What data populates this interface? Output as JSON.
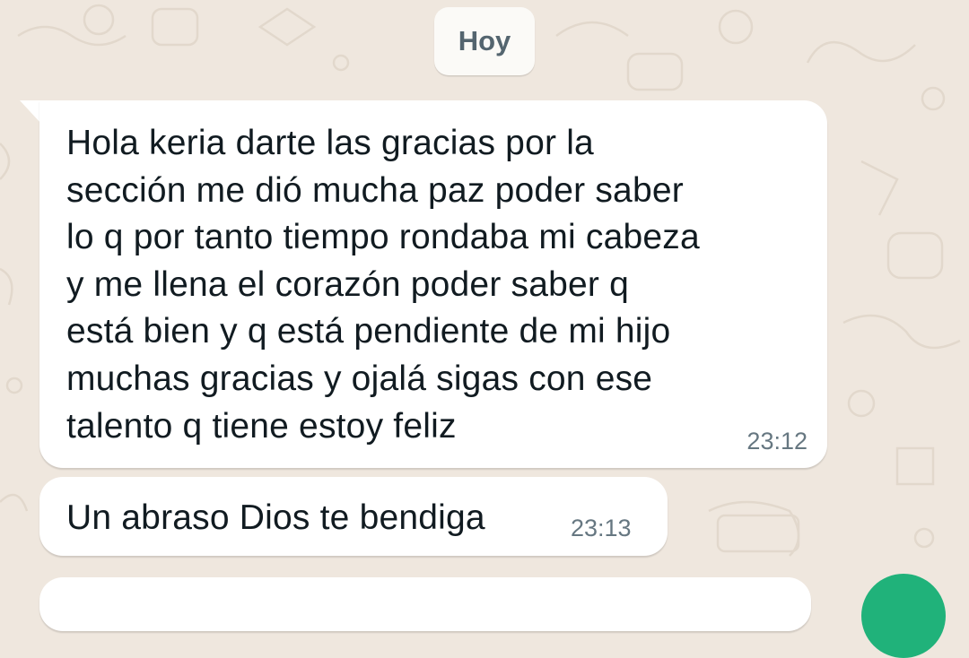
{
  "chat": {
    "date_chip": "Hoy",
    "messages": [
      {
        "lines": [
          "Hola keria darte las gracias por la",
          "sección me dió mucha paz poder saber",
          "lo q por tanto tiempo rondaba mi cabeza",
          "y me llena el corazón poder saber q",
          "está bien y q está pendiente de mi hijo",
          "muchas gracias y ojalá sigas con ese",
          "talento q tiene estoy feliz"
        ],
        "time": "23:12"
      },
      {
        "lines": [
          "Un abraso Dios te bendiga"
        ],
        "time": "23:13"
      }
    ]
  },
  "colors": {
    "chat_background": "#efe7de",
    "bubble_incoming": "#ffffff",
    "timestamp": "#667781",
    "date_chip_text": "#54656f",
    "fab_accent": "#20b27a"
  },
  "icons": {
    "fab": "scroll-down-button"
  }
}
